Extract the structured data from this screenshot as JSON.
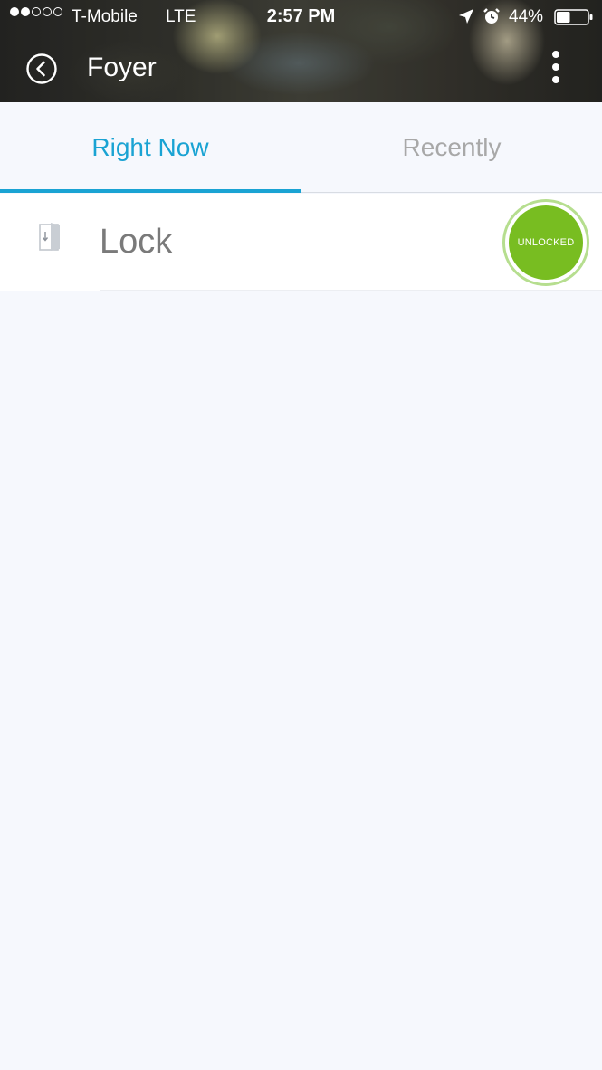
{
  "status_bar": {
    "carrier": "T-Mobile",
    "network": "LTE",
    "time": "2:57 PM",
    "battery": "44%",
    "signal_bars_filled": 2,
    "signal_bars_total": 5,
    "battery_level": 0.44
  },
  "nav": {
    "title": "Foyer",
    "back_icon": "back-circle-icon",
    "more_icon": "more-vertical-icon"
  },
  "tabs": [
    {
      "label": "Right Now",
      "active": true
    },
    {
      "label": "Recently",
      "active": false
    }
  ],
  "devices": [
    {
      "name": "Lock",
      "icon": "door-icon",
      "state": "UNLOCKED"
    }
  ],
  "colors": {
    "accent": "#1aa3d3",
    "inactive_tab": "#a8a8a8",
    "unlocked": "#78bd21",
    "background": "#f6f8fd"
  }
}
